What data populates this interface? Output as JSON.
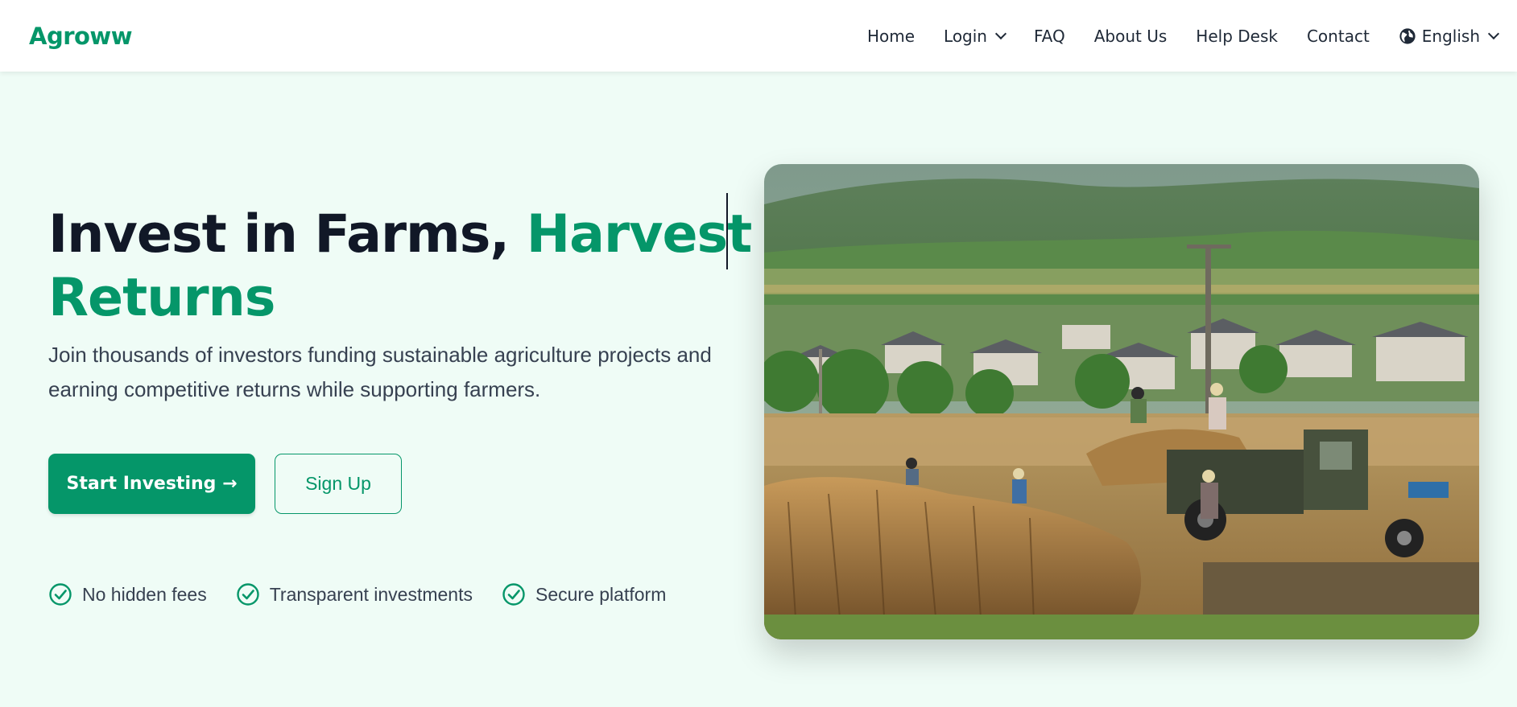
{
  "nav": {
    "brand": "Agroww",
    "items": [
      {
        "label": "Home"
      },
      {
        "label": "Login"
      },
      {
        "label": "FAQ"
      },
      {
        "label": "About Us"
      },
      {
        "label": "Help Desk"
      },
      {
        "label": "Contact"
      }
    ],
    "language": "English"
  },
  "hero": {
    "title_part1": "Invest in Farms, ",
    "title_accent_a": "Harves",
    "title_accent_b": "t",
    "title_accent_line2": "Returns",
    "subtitle": "Join thousands of investors funding sustainable agriculture projects and earning competitive returns while supporting farmers.",
    "primary_button": "Start Investing →",
    "secondary_button": "Sign Up",
    "features": [
      "No hidden fees",
      "Transparent investments",
      "Secure platform"
    ]
  },
  "colors": {
    "brand": "#059669",
    "background": "#effcf6",
    "heading": "#111827"
  },
  "icons": [
    "chevron-down-icon",
    "globe-icon",
    "check-circle-icon"
  ]
}
